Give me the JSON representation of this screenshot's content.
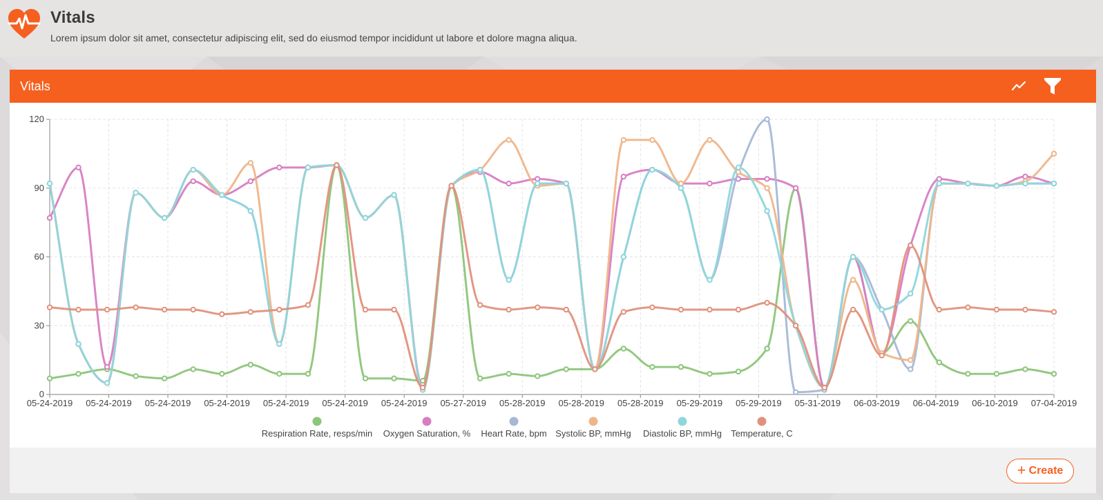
{
  "app": {
    "title": "Vitals",
    "subtitle": "Lorem ipsum dolor sit amet, consectetur adipiscing elit, sed do eiusmod tempor incididunt ut labore et dolore magna aliqua.",
    "logo_icon": "heart-pulse-icon",
    "accent": "#f5601f"
  },
  "panel": {
    "title": "Vitals",
    "chart_toggle_icon": "line-chart-icon",
    "filter_icon": "filter-icon"
  },
  "footer": {
    "create_label": "Create",
    "create_icon": "plus-icon"
  },
  "chart_data": {
    "type": "line",
    "categories": [
      "05-24-2019",
      "05-24-2019",
      "05-24-2019",
      "05-24-2019",
      "05-24-2019",
      "05-24-2019",
      "05-24-2019",
      "05-27-2019",
      "05-28-2019",
      "05-28-2019",
      "05-28-2019",
      "05-29-2019",
      "05-29-2019",
      "05-31-2019",
      "06-03-2019",
      "06-04-2019",
      "06-10-2019",
      "07-04-2019"
    ],
    "ylim": [
      0,
      120
    ],
    "yticks": [
      0,
      30,
      60,
      90,
      120
    ],
    "grid": true,
    "legend_position": "bottom",
    "series": [
      {
        "name": "Respiration Rate, resps/min",
        "color": "#8dc57a",
        "values": [
          7,
          9,
          11,
          8,
          7,
          11,
          9,
          13,
          9,
          9,
          100,
          7,
          7,
          6,
          91,
          7,
          9,
          8,
          11,
          11,
          20,
          12,
          12,
          9,
          10,
          20,
          90,
          3,
          60,
          18,
          32,
          14,
          9,
          9,
          11,
          9
        ]
      },
      {
        "name": "Oxygen Saturation, %",
        "color": "#d77ec3",
        "values": [
          77,
          99,
          12,
          88,
          77,
          93,
          87,
          93,
          99,
          99,
          100,
          77,
          87,
          3,
          91,
          97,
          92,
          94,
          92,
          11,
          95,
          98,
          92,
          92,
          94,
          94,
          90,
          3,
          60,
          18,
          65,
          94,
          92,
          91,
          95,
          92
        ]
      },
      {
        "name": "Heart Rate, bpm",
        "color": "#a7b8d6",
        "values": [
          92,
          22,
          5,
          88,
          77,
          98,
          87,
          80,
          22,
          99,
          100,
          77,
          87,
          2,
          91,
          98,
          50,
          92,
          92,
          11,
          60,
          98,
          90,
          50,
          97,
          120,
          1,
          2,
          60,
          37,
          11,
          92,
          92,
          91,
          92,
          92
        ]
      },
      {
        "name": "Systolic BP, mmHg",
        "color": "#efb58a",
        "values": [
          92,
          22,
          5,
          88,
          77,
          98,
          87,
          101,
          22,
          99,
          100,
          77,
          87,
          2,
          91,
          98,
          111,
          91,
          92,
          11,
          111,
          111,
          92,
          111,
          97,
          90,
          30,
          3,
          50,
          18,
          15,
          92,
          92,
          91,
          93,
          105
        ]
      },
      {
        "name": "Diastolic BP, mmHg",
        "color": "#8fd6dc",
        "values": [
          92,
          22,
          5,
          88,
          77,
          98,
          87,
          80,
          22,
          99,
          100,
          77,
          87,
          2,
          91,
          98,
          50,
          92,
          92,
          11,
          60,
          98,
          90,
          50,
          99,
          80,
          30,
          3,
          60,
          37,
          44,
          92,
          92,
          91,
          92,
          92
        ]
      },
      {
        "name": "Temperature, C",
        "color": "#e0917c",
        "values": [
          38,
          37,
          37,
          38,
          37,
          37,
          35,
          36,
          37,
          39,
          100,
          37,
          37,
          3,
          91,
          39,
          37,
          38,
          37,
          11,
          36,
          38,
          37,
          37,
          37,
          40,
          30,
          3,
          37,
          17,
          65,
          37,
          38,
          37,
          37,
          36
        ]
      }
    ]
  }
}
